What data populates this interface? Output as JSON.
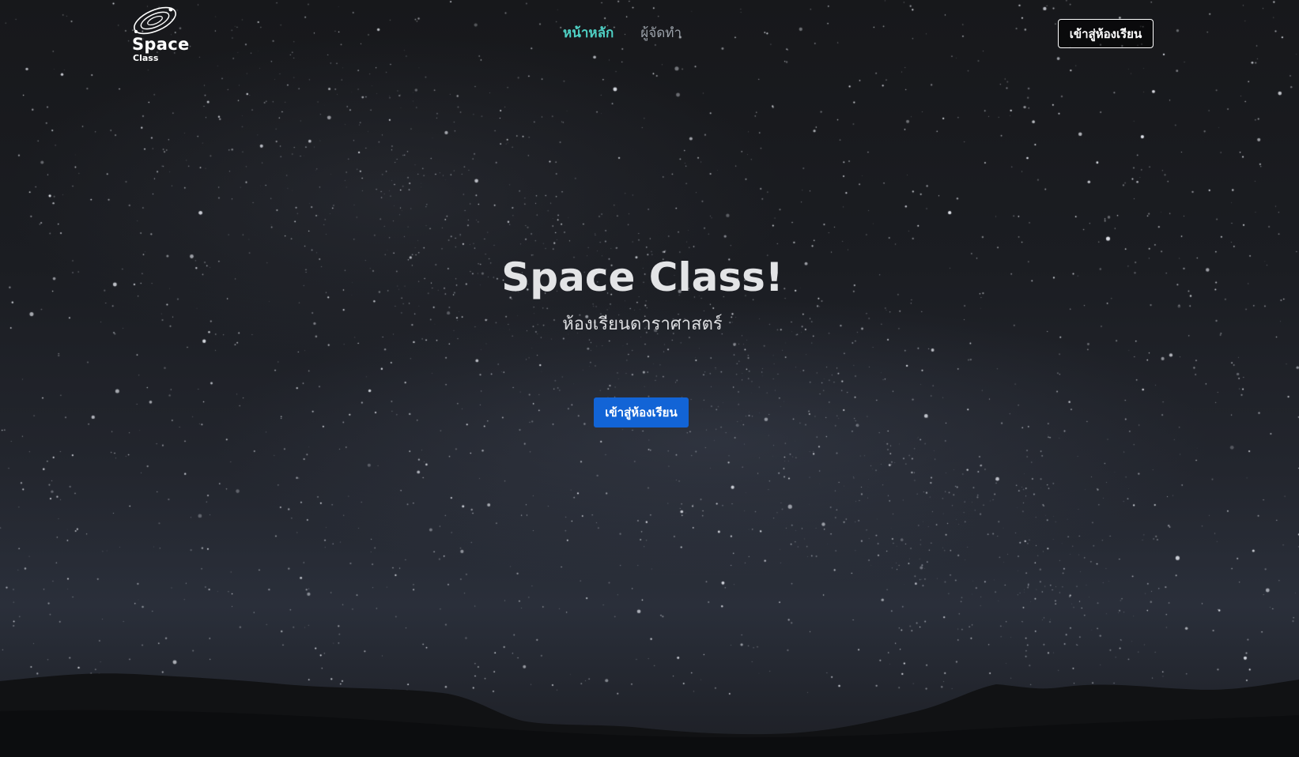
{
  "header": {
    "logo": {
      "title": "Space",
      "subtitle": "Class",
      "icon": "orbit-planet-icon"
    },
    "nav": [
      {
        "label": "หน้าหลัก",
        "active": true
      },
      {
        "label": "ผู้จัดทำ",
        "active": false
      }
    ],
    "cta_label": "เข้าสู่ห้องเรียน"
  },
  "hero": {
    "title": "Space Class!",
    "subtitle": "ห้องเรียนดาราศาสตร์",
    "cta_label": "เข้าสู่ห้องเรียน"
  },
  "colors": {
    "nav_active": "#4fd1c5",
    "nav_muted": "#9aa0a8",
    "primary_button": "#1264d6",
    "background": "#141518"
  },
  "background": {
    "scene": "starry-night-sky",
    "icon": "milky-way-stars"
  }
}
